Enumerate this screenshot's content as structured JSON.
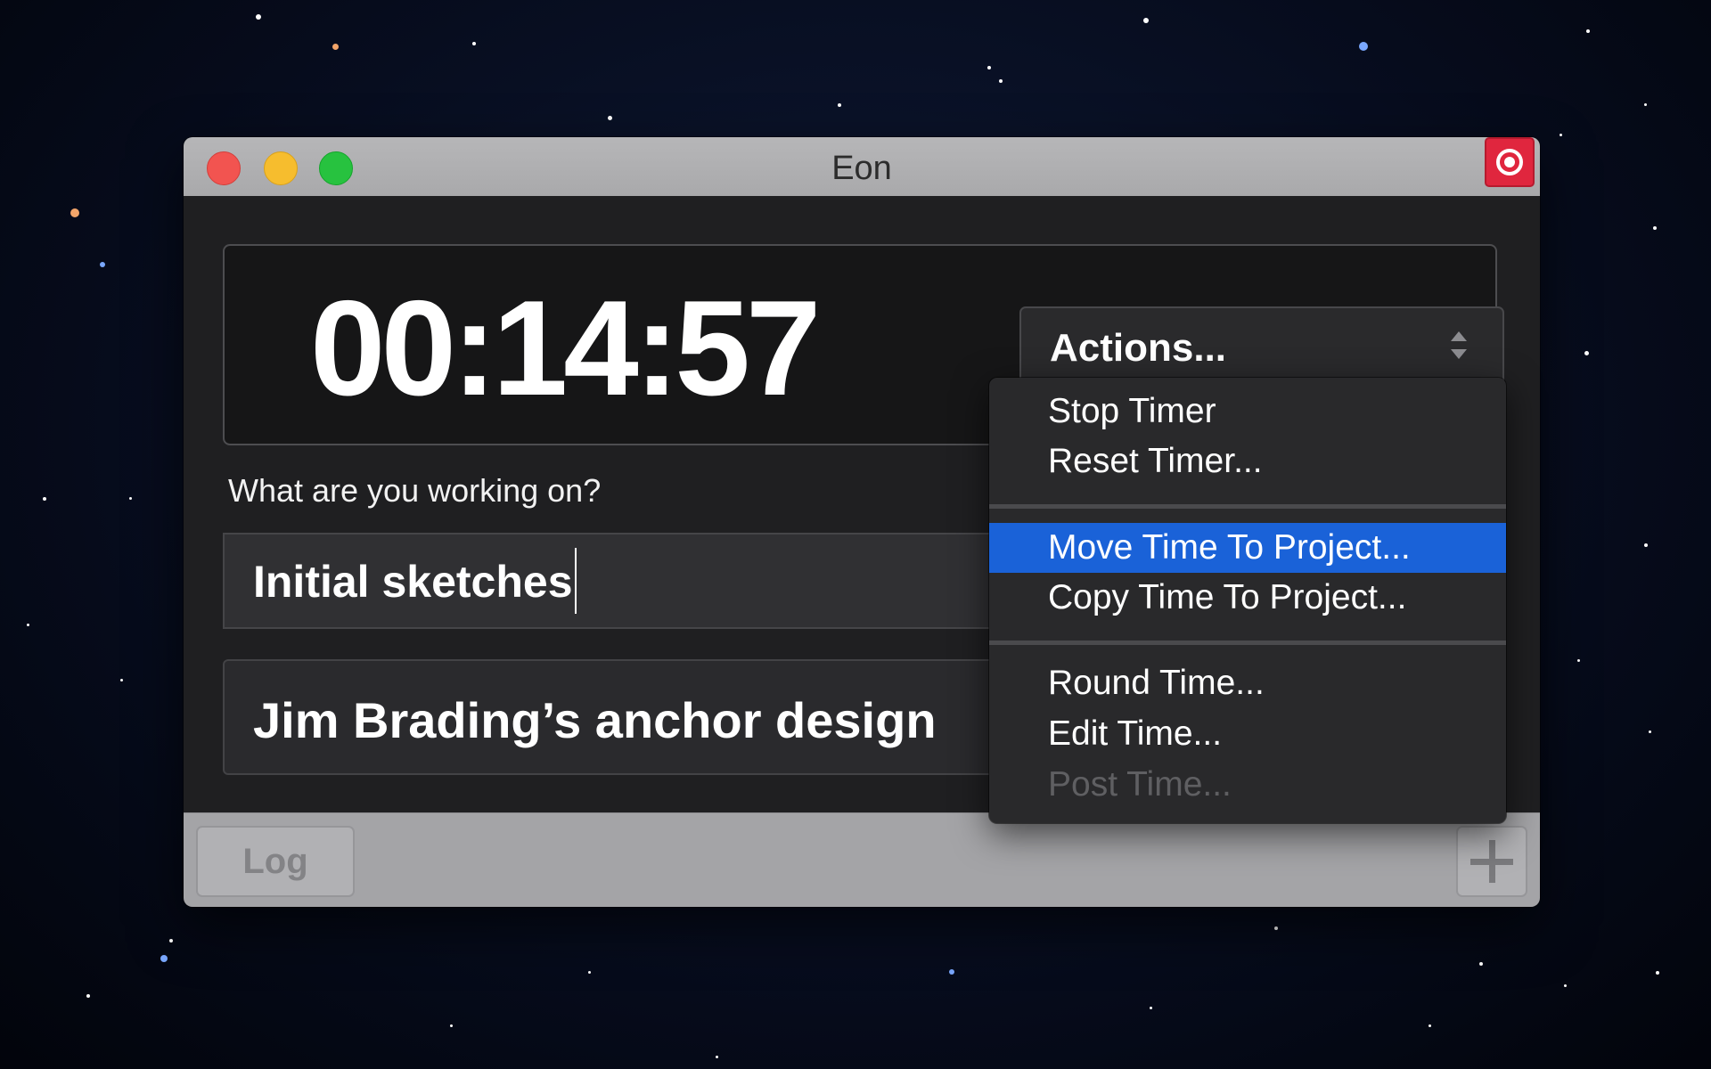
{
  "window": {
    "title": "Eon"
  },
  "timer": {
    "display": "00:14:57"
  },
  "actions": {
    "label": "Actions..."
  },
  "task": {
    "prompt": "What are you working on?",
    "value": "Initial sketches"
  },
  "project": {
    "name": "Jim Brading’s anchor design"
  },
  "footer": {
    "log_label": "Log",
    "add_icon": "plus-icon"
  },
  "menu": {
    "items": [
      {
        "label": "Stop Timer",
        "state": "enabled"
      },
      {
        "label": "Reset Timer...",
        "state": "enabled"
      },
      {
        "label": "Move Time To Project...",
        "state": "highlighted"
      },
      {
        "label": "Copy Time To Project...",
        "state": "enabled"
      },
      {
        "label": "Round Time...",
        "state": "enabled"
      },
      {
        "label": "Edit Time...",
        "state": "enabled"
      },
      {
        "label": "Post Time...",
        "state": "disabled"
      }
    ]
  },
  "colors": {
    "menu_highlight": "#1a62d8",
    "record_button": "#e0263e",
    "close": "#f25450",
    "minimize": "#f6bd2e",
    "maximize": "#27c23f"
  }
}
